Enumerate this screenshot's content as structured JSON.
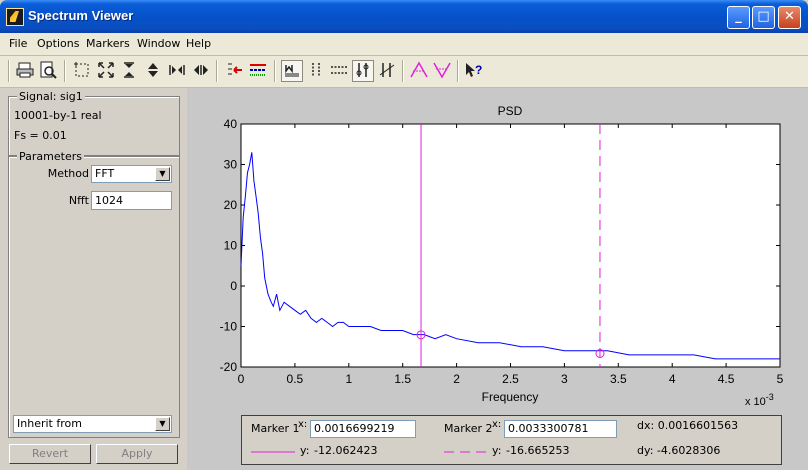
{
  "window": {
    "title": "Spectrum Viewer",
    "minimize": "_",
    "maximize": "□",
    "close": "✕"
  },
  "menu": [
    "File",
    "Options",
    "Markers",
    "Window",
    "Help"
  ],
  "toolbar_icons": [
    "print-icon",
    "print-preview-icon",
    "select-region-icon",
    "zoom-full-icon",
    "zoom-x-icon",
    "zoom-y-icon",
    "zoom-in-x-icon",
    "zoom-out-x-icon",
    "spectrum-select-icon",
    "spectrum-properties-icon",
    "markers-icon",
    "vertical-markers-icon",
    "horizontal-markers-icon",
    "track-markers-icon",
    "slope-markers-icon",
    "peak-markers-icon",
    "valley-markers-icon",
    "whats-this-icon"
  ],
  "signal": {
    "label": "Signal: sig1",
    "size": "10001-by-1 real",
    "fs": "Fs = 0.01"
  },
  "parameters": {
    "label": "Parameters",
    "method_label": "Method",
    "method_value": "FFT",
    "nfft_label": "Nfft",
    "nfft_value": "1024",
    "inherit_value": "Inherit from",
    "revert_label": "Revert",
    "apply_label": "Apply"
  },
  "markers": {
    "marker1_label": "Marker 1",
    "marker2_label": "Marker 2",
    "x_label": "x:",
    "y_label": "y:",
    "marker1_x": "0.0016699219",
    "marker2_x": "0.0033300781",
    "marker1_y": "-12.062423",
    "marker2_y": "-16.665253",
    "dx": "dx: 0.0016601563",
    "dy": "dy: -4.6028306",
    "colors": {
      "marker": "#e020e0"
    }
  },
  "chart_data": {
    "type": "line",
    "title": "PSD",
    "xlabel": "Frequency",
    "ylabel": "",
    "x_exponent": "x 10",
    "x_exponent_power": "-3",
    "xlim": [
      0,
      5
    ],
    "ylim": [
      -20,
      40
    ],
    "xticks": [
      "0",
      "0.5",
      "1",
      "1.5",
      "2",
      "2.5",
      "3",
      "3.5",
      "4",
      "4.5",
      "5"
    ],
    "yticks": [
      "40",
      "30",
      "20",
      "10",
      "0",
      "-10",
      "-20"
    ],
    "vertical_markers": [
      1.67,
      3.33
    ],
    "series": [
      {
        "color": "#0000ff",
        "x": [
          0,
          0.02,
          0.04,
          0.06,
          0.08,
          0.1,
          0.12,
          0.14,
          0.16,
          0.18,
          0.2,
          0.22,
          0.25,
          0.28,
          0.3,
          0.33,
          0.36,
          0.4,
          0.45,
          0.5,
          0.55,
          0.6,
          0.65,
          0.7,
          0.75,
          0.8,
          0.85,
          0.9,
          0.95,
          1.0,
          1.1,
          1.2,
          1.3,
          1.4,
          1.5,
          1.6,
          1.7,
          1.8,
          1.9,
          2.0,
          2.2,
          2.4,
          2.6,
          2.8,
          3.0,
          3.2,
          3.4,
          3.6,
          3.8,
          4.0,
          4.2,
          4.4,
          4.6,
          4.8,
          5.0
        ],
        "y": [
          5,
          17,
          22,
          28,
          30,
          33,
          26,
          22,
          18,
          12,
          8,
          2,
          -2,
          -4,
          -5,
          -2,
          -6,
          -4,
          -5,
          -6,
          -7,
          -6,
          -8,
          -9,
          -8,
          -9,
          -10,
          -9,
          -9,
          -10,
          -10,
          -10,
          -11,
          -11,
          -11,
          -12,
          -12,
          -13,
          -12,
          -13,
          -14,
          -14,
          -15,
          -15,
          -16,
          -16,
          -16,
          -17,
          -17,
          -17,
          -17,
          -18,
          -18,
          -18,
          -18
        ]
      }
    ]
  }
}
